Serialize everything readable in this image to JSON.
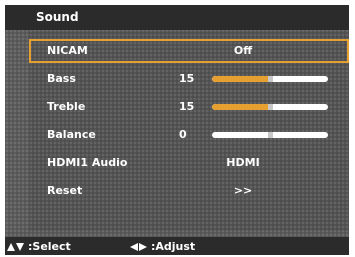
{
  "menu": {
    "title": "Sound"
  },
  "rows": [
    {
      "label": "NICAM",
      "value": "Off"
    },
    {
      "label": "Bass",
      "value": "15",
      "level": 0.5
    },
    {
      "label": "Treble",
      "value": "15",
      "level": 0.5
    },
    {
      "label": "Balance",
      "value": "0",
      "level": 0.5
    },
    {
      "label": "HDMI1 Audio",
      "value": "HDMI"
    },
    {
      "label": "Reset",
      "value": ">>"
    }
  ],
  "footer": {
    "select_label": ":Select",
    "adjust_label": ":Adjust"
  },
  "colors": {
    "accent": "#e6a032",
    "panel": "#5c5c5c",
    "bar": "#2b2b2b"
  }
}
